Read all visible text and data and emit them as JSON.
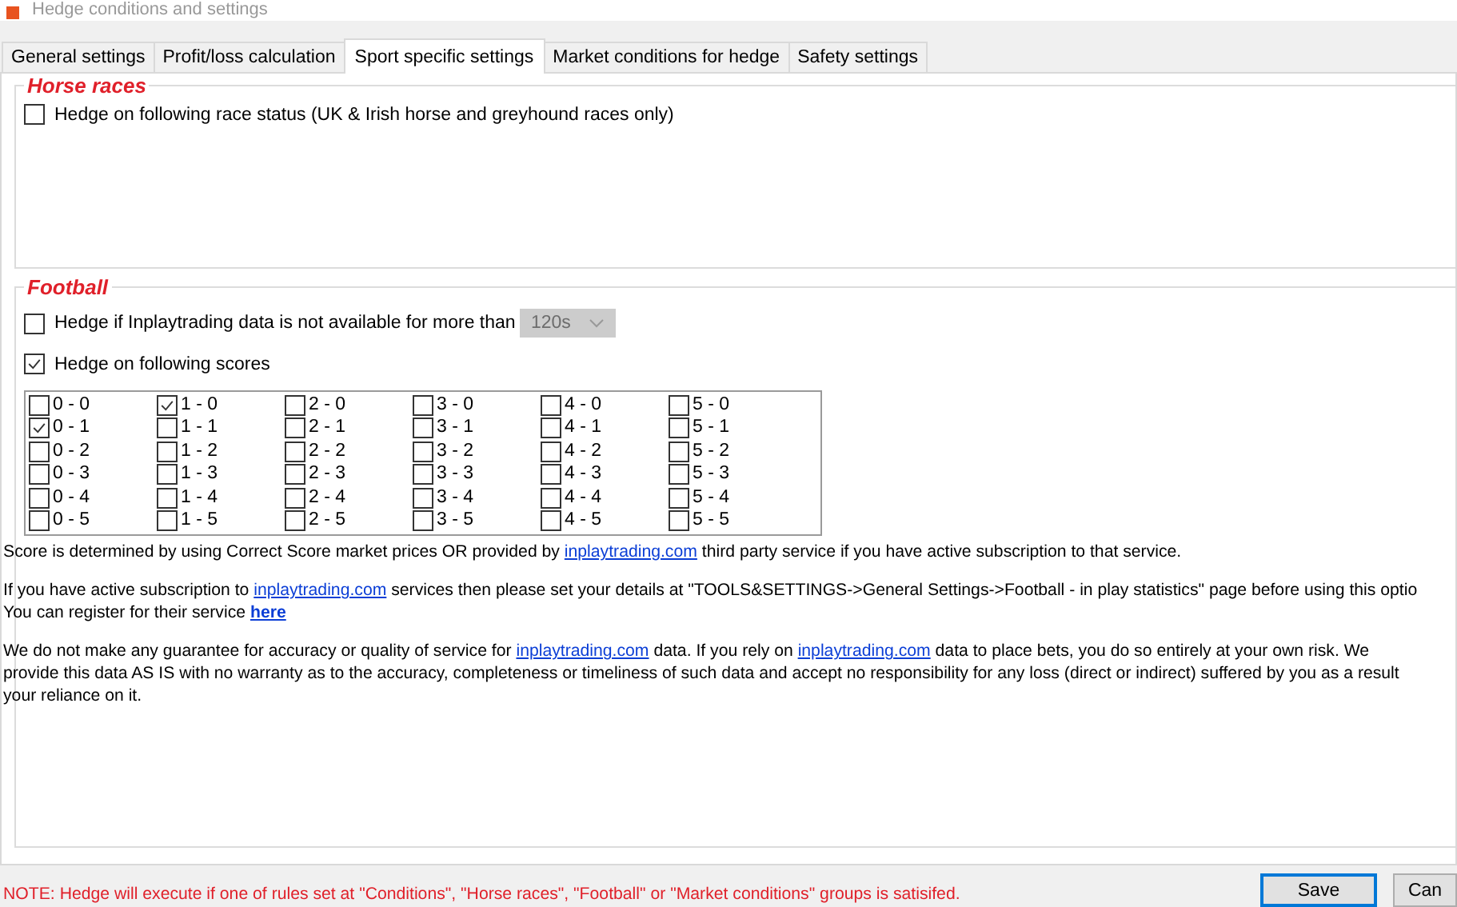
{
  "window": {
    "title": "Hedge conditions and settings"
  },
  "tabs": [
    {
      "label": "General settings",
      "selected": false
    },
    {
      "label": "Profit/loss calculation",
      "selected": false
    },
    {
      "label": "Sport specific settings",
      "selected": true
    },
    {
      "label": "Market conditions for hedge",
      "selected": false
    },
    {
      "label": "Safety settings",
      "selected": false
    }
  ],
  "horse_races": {
    "title": "Horse races",
    "option": {
      "label": "Hedge on following race status (UK & Irish horse and greyhound races only)",
      "checked": false
    }
  },
  "football": {
    "title": "Football",
    "unavailable_option": {
      "label": "Hedge if Inplaytrading data is not available for more than",
      "checked": false,
      "dropdown": {
        "value": "120s",
        "disabled": true
      }
    },
    "scores_option": {
      "label": "Hedge on following scores",
      "checked": true
    },
    "scores": [
      {
        "label": "0 - 0",
        "checked": false
      },
      {
        "label": "1 - 0",
        "checked": true
      },
      {
        "label": "2 - 0",
        "checked": false
      },
      {
        "label": "3 - 0",
        "checked": false
      },
      {
        "label": "4 - 0",
        "checked": false
      },
      {
        "label": "5 - 0",
        "checked": false
      },
      {
        "label": "0 - 1",
        "checked": true
      },
      {
        "label": "1 - 1",
        "checked": false
      },
      {
        "label": "2 - 1",
        "checked": false
      },
      {
        "label": "3 - 1",
        "checked": false
      },
      {
        "label": "4 - 1",
        "checked": false
      },
      {
        "label": "5 - 1",
        "checked": false
      },
      {
        "label": "0 - 2",
        "checked": false
      },
      {
        "label": "1 - 2",
        "checked": false
      },
      {
        "label": "2 - 2",
        "checked": false
      },
      {
        "label": "3 - 2",
        "checked": false
      },
      {
        "label": "4 - 2",
        "checked": false
      },
      {
        "label": "5 - 2",
        "checked": false
      },
      {
        "label": "0 - 3",
        "checked": false
      },
      {
        "label": "1 - 3",
        "checked": false
      },
      {
        "label": "2 - 3",
        "checked": false
      },
      {
        "label": "3 - 3",
        "checked": false
      },
      {
        "label": "4 - 3",
        "checked": false
      },
      {
        "label": "5 - 3",
        "checked": false
      },
      {
        "label": "0 - 4",
        "checked": false
      },
      {
        "label": "1 - 4",
        "checked": false
      },
      {
        "label": "2 - 4",
        "checked": false
      },
      {
        "label": "3 - 4",
        "checked": false
      },
      {
        "label": "4 - 4",
        "checked": false
      },
      {
        "label": "5 - 4",
        "checked": false
      },
      {
        "label": "0 - 5",
        "checked": false
      },
      {
        "label": "1 - 5",
        "checked": false
      },
      {
        "label": "2 - 5",
        "checked": false
      },
      {
        "label": "3 - 5",
        "checked": false
      },
      {
        "label": "4 - 5",
        "checked": false
      },
      {
        "label": "5 - 5",
        "checked": false
      }
    ],
    "paragraphs": [
      {
        "lines": [
          [
            {
              "kind": "text",
              "text": "Score is determined by using Correct Score market prices OR provided by "
            },
            {
              "kind": "link",
              "text": "inplaytrading.com"
            },
            {
              "kind": "text",
              "text": " third party service if you have active subscription to that service."
            }
          ]
        ]
      },
      {
        "lines": [
          [
            {
              "kind": "text",
              "text": "If you have active subscription to "
            },
            {
              "kind": "link",
              "text": "inplaytrading.com"
            },
            {
              "kind": "text",
              "text": " services then please set your details at \"TOOLS&SETTINGS->General Settings->Football - in play statistics\" page before using this optio"
            }
          ],
          [
            {
              "kind": "text",
              "text": "You can register for their service "
            },
            {
              "kind": "bold_link",
              "text": "here"
            }
          ]
        ]
      },
      {
        "lines": [
          [
            {
              "kind": "text",
              "text": "We do not make any guarantee for accuracy or quality of service for "
            },
            {
              "kind": "link",
              "text": "inplaytrading.com"
            },
            {
              "kind": "text",
              "text": " data. If you rely on "
            },
            {
              "kind": "link",
              "text": "inplaytrading.com"
            },
            {
              "kind": "text",
              "text": " data to place bets, you do so entirely at your own risk. We"
            }
          ],
          [
            {
              "kind": "text",
              "text": "provide this data AS IS with no warranty as to the accuracy, completeness or timeliness of such data and accept no responsibility for any loss (direct or indirect) suffered by you as a result"
            }
          ],
          [
            {
              "kind": "text",
              "text": "your reliance on it."
            }
          ]
        ]
      }
    ]
  },
  "footer": {
    "note": "NOTE: Hedge will execute if one of rules set at \"Conditions\", \"Horse races\", \"Football\" or \"Market conditions\" groups is satisifed.",
    "buttons": [
      {
        "label": "Save",
        "kind": "default"
      },
      {
        "label": "Can",
        "kind": "normal"
      }
    ]
  }
}
